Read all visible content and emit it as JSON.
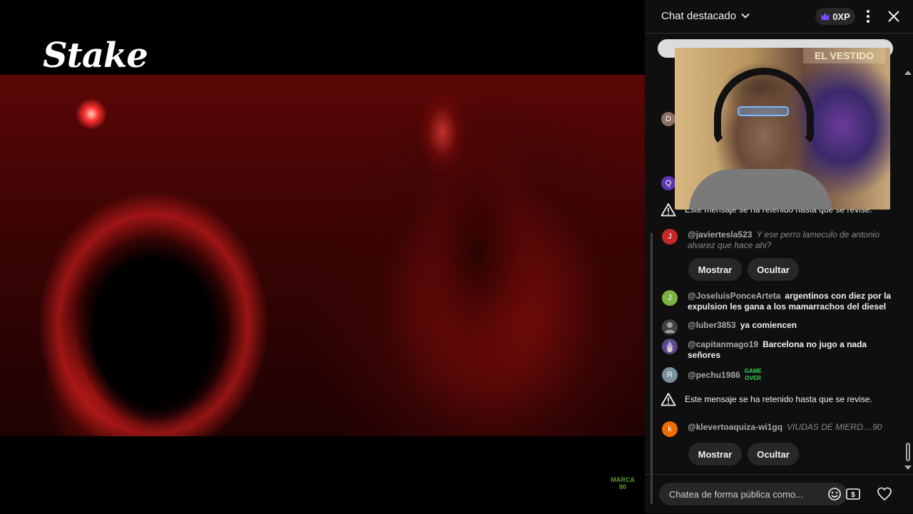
{
  "video": {
    "logo": "Stake",
    "watermark": "MARCA 90"
  },
  "chat": {
    "title": "Chat destacado",
    "xp": "0XP",
    "mini_avatars": [
      {
        "letter": "D",
        "color": "#8d6e63"
      },
      {
        "letter": "Q",
        "color": "#5e35b1"
      }
    ],
    "overlay_sign": "EL VESTIDO",
    "held_notice": "Este mensaje se ha retenido hasta que se revise.",
    "show_label": "Mostrar",
    "hide_label": "Ocultar",
    "messages": [
      {
        "avatar": "J",
        "color": "#c62828",
        "author": "@javiertesla523",
        "text": "Y ese perro lameculo de antonio alvarez que hace ahi?"
      },
      {
        "avatar": "J",
        "color": "#7cb342",
        "author": "@JoseluisPonceArteta",
        "text": "argentinos con diez por la expulsion les gana a los mamarrachos del diesel"
      },
      {
        "avatar": "",
        "color": "#424242",
        "author": "@luber3853",
        "text": "ya comiencen"
      },
      {
        "avatar": "",
        "color": "#5c4a8a",
        "author": "@capitanmago19",
        "text": "Barcelona no jugo a nada señores"
      },
      {
        "avatar": "R",
        "color": "#78909c",
        "author": "@pechu1986",
        "text": "GAME OVER"
      },
      {
        "avatar": "k",
        "color": "#ef6c00",
        "author": "@klevertoaquiza-wi1gq",
        "text": "VIUDAS DE MIERD....90"
      }
    ],
    "input_placeholder": "Chatea de forma pública como..."
  }
}
